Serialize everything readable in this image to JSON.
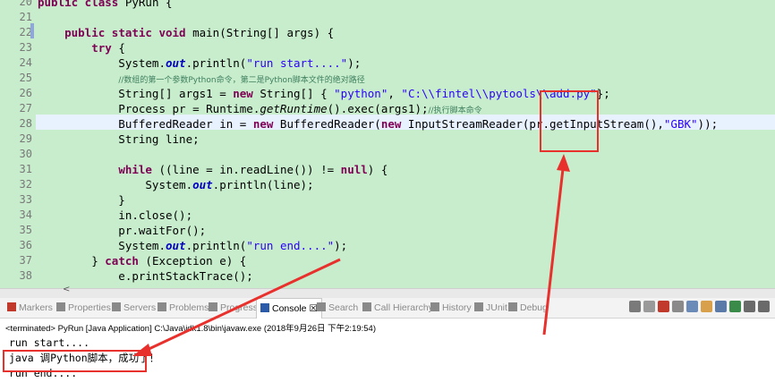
{
  "editor": {
    "line_numbers": [
      "20",
      "21",
      "22",
      "23",
      "24",
      "25",
      "26",
      "27",
      "28",
      "29",
      "30",
      "31",
      "32",
      "33",
      "34",
      "35",
      "36",
      "37",
      "38"
    ],
    "lines": [
      [
        {
          "t": "public class",
          "c": "kw"
        },
        {
          "t": " PyRun {"
        }
      ],
      [],
      [
        {
          "t": "    "
        },
        {
          "t": "public static void",
          "c": "kw"
        },
        {
          "t": " main(String[] args) {"
        }
      ],
      [
        {
          "t": "        "
        },
        {
          "t": "try",
          "c": "kw"
        },
        {
          "t": " {"
        }
      ],
      [
        {
          "t": "            System."
        },
        {
          "t": "out",
          "c": "fld"
        },
        {
          "t": ".println("
        },
        {
          "t": "\"run start....\"",
          "c": "str"
        },
        {
          "t": ");"
        }
      ],
      [
        {
          "t": "            "
        },
        {
          "t": "//数组的第一个参数Python命令，第二是Python脚本文件的绝对路径",
          "c": "cmt"
        }
      ],
      [
        {
          "t": "            String[] args1 = "
        },
        {
          "t": "new",
          "c": "kw"
        },
        {
          "t": " String[] { "
        },
        {
          "t": "\"python\"",
          "c": "str"
        },
        {
          "t": ", "
        },
        {
          "t": "\"C:\\\\fintel\\\\pytools\\\\add.py\"",
          "c": "str"
        },
        {
          "t": "};"
        }
      ],
      [
        {
          "t": "            Process pr = Runtime."
        },
        {
          "t": "getRuntime",
          "c": "itl"
        },
        {
          "t": "().exec(args1);"
        },
        {
          "t": "//执行脚本命令",
          "c": "cmt"
        }
      ],
      [
        {
          "t": "            BufferedReader in = "
        },
        {
          "t": "new",
          "c": "kw"
        },
        {
          "t": " BufferedReader("
        },
        {
          "t": "new",
          "c": "kw"
        },
        {
          "t": " InputStreamReader(pr.getInputStream(),"
        },
        {
          "t": "\"GBK\"",
          "c": "str"
        },
        {
          "t": "));"
        }
      ],
      [
        {
          "t": "            String line;"
        }
      ],
      [],
      [
        {
          "t": "            "
        },
        {
          "t": "while",
          "c": "kw"
        },
        {
          "t": " ((line = in.readLine()) != "
        },
        {
          "t": "null",
          "c": "kw"
        },
        {
          "t": ") {"
        }
      ],
      [
        {
          "t": "                System."
        },
        {
          "t": "out",
          "c": "fld"
        },
        {
          "t": ".println(line);"
        }
      ],
      [
        {
          "t": "            }"
        }
      ],
      [
        {
          "t": "            in.close();"
        }
      ],
      [
        {
          "t": "            pr.waitFor();"
        }
      ],
      [
        {
          "t": "            System."
        },
        {
          "t": "out",
          "c": "fld"
        },
        {
          "t": ".println("
        },
        {
          "t": "\"run end....\"",
          "c": "str"
        },
        {
          "t": ");"
        }
      ],
      [
        {
          "t": "        } "
        },
        {
          "t": "catch",
          "c": "kw"
        },
        {
          "t": " (Exception e) {"
        }
      ],
      [
        {
          "t": "            e.printStackTrace();"
        }
      ]
    ]
  },
  "tabs": [
    {
      "label": "Markers",
      "icon": "markers-icon",
      "color": "#c0392b"
    },
    {
      "label": "Properties",
      "icon": "properties-icon",
      "color": "#8a8a8a"
    },
    {
      "label": "Servers",
      "icon": "servers-icon",
      "color": "#8a8a8a"
    },
    {
      "label": "Problems",
      "icon": "problems-icon",
      "color": "#8a8a8a"
    },
    {
      "label": "Progress",
      "icon": "progress-icon",
      "color": "#8a8a8a"
    },
    {
      "label": "Console ☒",
      "icon": "console-icon",
      "color": "#2b5aa8",
      "active": true
    },
    {
      "label": "Search",
      "icon": "search-icon",
      "color": "#8a8a8a"
    },
    {
      "label": "Call Hierarchy",
      "icon": "call-hierarchy-icon",
      "color": "#8a8a8a"
    },
    {
      "label": "History",
      "icon": "history-icon",
      "color": "#8a8a8a"
    },
    {
      "label": "JUnit",
      "icon": "junit-icon",
      "color": "#8a8a8a"
    },
    {
      "label": "Debug",
      "icon": "debug-icon",
      "color": "#8a8a8a"
    }
  ],
  "toolbar_icons": [
    "terminate-icon",
    "remove-launch-icon",
    "remove-all-icon",
    "scroll-lock-icon",
    "clear-console-icon",
    "pin-console-icon",
    "word-wrap-icon",
    "display-console-icon",
    "open-console-icon",
    "view-menu-icon"
  ],
  "console": {
    "status": "<terminated> PyRun [Java Application] C:\\Java\\jdk1.8\\bin\\javaw.exe (2018年9月26日 下午2:19:54)",
    "output": [
      "run start....",
      "java 调Python脚本，成功了！",
      "run end...."
    ]
  },
  "annotation_color": "#e8302c"
}
